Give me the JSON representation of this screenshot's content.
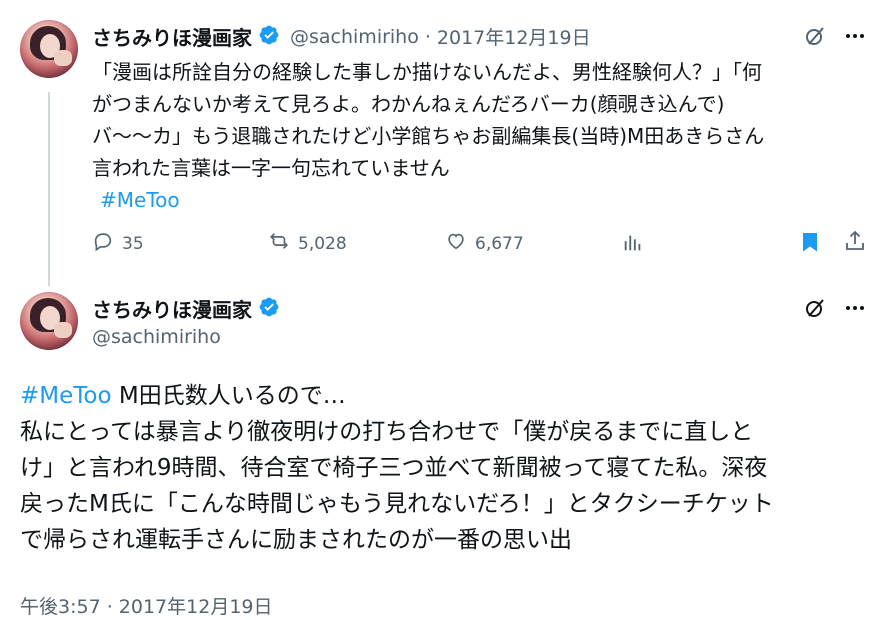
{
  "tweet1": {
    "author_name": "さちみりほ漫画家",
    "handle": "@sachimiriho",
    "separator": "·",
    "date": "2017年12月19日",
    "body_lines": [
      "「漫画は所詮自分の経験した事しか描けないんだよ、男性経験何人？」「何",
      "がつまんないか考えて見ろよ。わかんねぇんだろバーカ(顔覗き込んで)",
      "バ〜〜カ」もう退職されたけど小学館ちゃお副編集長(当時)M田あきらさん",
      "言われた言葉は一字一句忘れていません"
    ],
    "hashtag": "#MeToo",
    "replies": "35",
    "retweets": "5,028",
    "likes": "6,677"
  },
  "tweet2": {
    "author_name": "さちみりほ漫画家",
    "handle": "@sachimiriho",
    "hashtag": "#MeToo",
    "first_line_rest": " M田氏数人いるので…",
    "body_lines": [
      "私にとっては暴言より徹夜明けの打ち合わせで「僕が戻るまでに直しと",
      "け」と言われ9時間、待合室で椅子三つ並べて新聞被って寝てた私。深夜",
      "戻ったM氏に「こんな時間じゃもう見れないだろ！」とタクシーチケット",
      "で帰らされ運転手さんに励まされたのが一番の思い出"
    ],
    "timestamp": "午後3:57 · 2017年12月19日"
  },
  "colors": {
    "accent": "#1d9bf0",
    "bookmark": "#1d9bf0",
    "secondary_text": "#536471",
    "primary_text": "#0f1419"
  },
  "icons": {
    "verified": "verified-badge-icon",
    "grok": "grok-icon",
    "more": "more-icon",
    "reply": "reply-icon",
    "retweet": "retweet-icon",
    "like": "like-icon",
    "views": "views-icon",
    "bookmark": "bookmark-icon",
    "share": "share-icon"
  }
}
